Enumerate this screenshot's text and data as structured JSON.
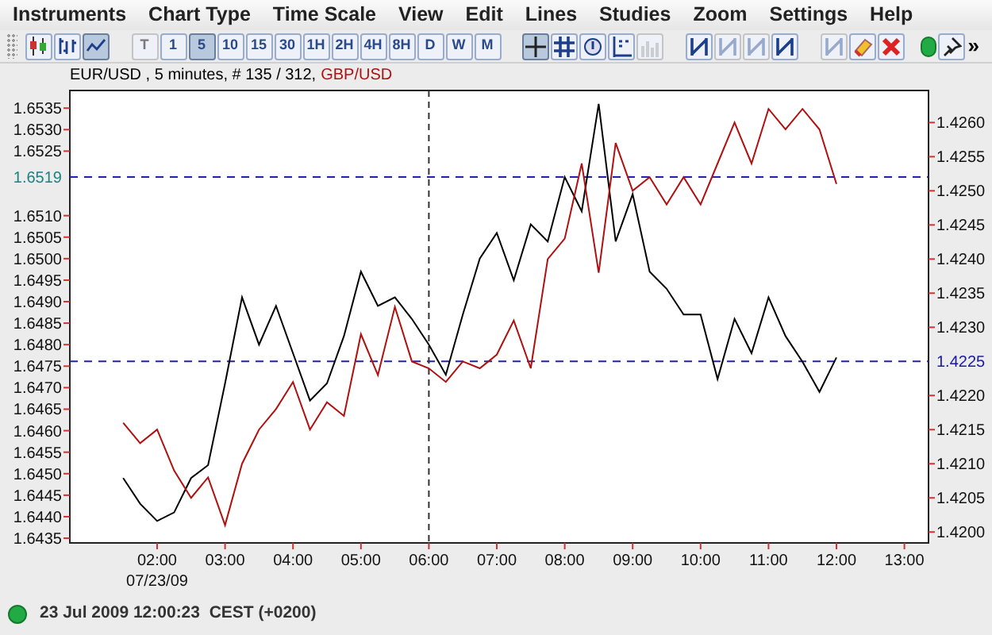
{
  "menu": [
    "Instruments",
    "Chart Type",
    "Time Scale",
    "View",
    "Edit",
    "Lines",
    "Studies",
    "Zoom",
    "Settings",
    "Help"
  ],
  "toolbar": {
    "chart_type_buttons": [
      {
        "selected": false
      },
      {
        "selected": false
      },
      {
        "selected": true
      }
    ],
    "time_scale_buttons": [
      {
        "label": "T",
        "disabled": true,
        "selected": false
      },
      {
        "label": "1",
        "disabled": false,
        "selected": false
      },
      {
        "label": "5",
        "disabled": false,
        "selected": true
      },
      {
        "label": "10",
        "disabled": false,
        "selected": false
      },
      {
        "label": "15",
        "disabled": false,
        "selected": false
      },
      {
        "label": "30",
        "disabled": false,
        "selected": false
      },
      {
        "label": "1H",
        "disabled": false,
        "selected": false
      },
      {
        "label": "2H",
        "disabled": false,
        "selected": false
      },
      {
        "label": "4H",
        "disabled": false,
        "selected": false
      },
      {
        "label": "8H",
        "disabled": false,
        "selected": false
      },
      {
        "label": "D",
        "disabled": false,
        "selected": false
      },
      {
        "label": "W",
        "disabled": false,
        "selected": false
      },
      {
        "label": "M",
        "disabled": false,
        "selected": false
      }
    ],
    "tool_buttons": [
      {
        "selected": true,
        "disabled": false
      },
      {
        "selected": false,
        "disabled": false
      },
      {
        "selected": false,
        "disabled": false
      },
      {
        "selected": false,
        "disabled": false
      },
      {
        "selected": false,
        "disabled": true
      }
    ],
    "line_buttons": [
      {
        "disabled": false
      },
      {
        "disabled": true
      },
      {
        "disabled": true
      },
      {
        "disabled": false
      }
    ],
    "edit_buttons": [
      {
        "disabled": true
      },
      {
        "disabled": false
      },
      {
        "disabled": false
      }
    ],
    "connected": true,
    "more": "»"
  },
  "chart": {
    "legend_info": " , 5 minutes, # 135 / 312,",
    "price_markers": [
      {
        "text": "1.6519",
        "color": "#208080"
      },
      {
        "text": "1.4225",
        "color": "#1a1aa0"
      }
    ],
    "date_label": "07/23/09",
    "chart_data": {
      "type": "line",
      "x": [
        1.5,
        1.75,
        2,
        2.25,
        2.5,
        2.75,
        3,
        3.25,
        3.5,
        3.75,
        4,
        4.25,
        4.5,
        4.75,
        5,
        5.25,
        5.5,
        5.75,
        6,
        6.25,
        6.5,
        6.75,
        7,
        7.25,
        7.5,
        7.75,
        8,
        8.25,
        8.5,
        8.75,
        9,
        9.25,
        9.5,
        9.75,
        10,
        10.25,
        10.5,
        10.75,
        11,
        11.25,
        11.5,
        11.75,
        12
      ],
      "series": [
        {
          "name": "EUR/USD",
          "color": "#000000",
          "values": [
            1.6449,
            1.6443,
            1.6439,
            1.6441,
            1.6449,
            1.6452,
            1.6471,
            1.6491,
            1.648,
            1.6489,
            1.6478,
            1.6467,
            1.6471,
            1.6482,
            1.6497,
            1.6489,
            1.6491,
            1.6486,
            1.648,
            1.6473,
            1.6487,
            1.65,
            1.6506,
            1.6495,
            1.6508,
            1.6504,
            1.6519,
            1.6511,
            1.6536,
            1.6504,
            1.6515,
            1.6497,
            1.6493,
            1.6487,
            1.6487,
            1.6472,
            1.6486,
            1.6478,
            1.6491,
            1.6482,
            1.6476,
            1.6469,
            1.6477
          ]
        },
        {
          "name": "GBP/USD",
          "color": "#b01010",
          "axis": "y2",
          "values": [
            1.4216,
            1.4213,
            1.4215,
            1.4209,
            1.4205,
            1.4208,
            1.4201,
            1.421,
            1.4215,
            1.4218,
            1.4222,
            1.4215,
            1.4219,
            1.4217,
            1.4229,
            1.4223,
            1.4233,
            1.4225,
            1.4224,
            1.4222,
            1.4225,
            1.4224,
            1.4226,
            1.4231,
            1.4224,
            1.424,
            1.4243,
            1.4254,
            1.4238,
            1.4257,
            1.425,
            1.4252,
            1.4248,
            1.4252,
            1.4248,
            1.4254,
            1.426,
            1.4254,
            1.4262,
            1.4259,
            1.4262,
            1.4259,
            1.4251
          ]
        }
      ],
      "xlim": [
        0.715,
        13.355
      ],
      "xticks": [
        {
          "value": 2,
          "label": "02:00"
        },
        {
          "value": 3,
          "label": "03:00"
        },
        {
          "value": 4,
          "label": "04:00"
        },
        {
          "value": 5,
          "label": "05:00"
        },
        {
          "value": 6,
          "label": "06:00"
        },
        {
          "value": 7,
          "label": "07:00"
        },
        {
          "value": 8,
          "label": "08:00"
        },
        {
          "value": 9,
          "label": "09:00"
        },
        {
          "value": 10,
          "label": "10:00"
        },
        {
          "value": 11,
          "label": "11:00"
        },
        {
          "value": 12,
          "label": "12:00"
        },
        {
          "value": 13,
          "label": "13:00"
        }
      ],
      "ylim": [
        1.64339,
        1.65391
      ],
      "yticks": [
        {
          "value": 1.6435,
          "label": "1.6435"
        },
        {
          "value": 1.644,
          "label": "1.6440"
        },
        {
          "value": 1.6445,
          "label": "1.6445"
        },
        {
          "value": 1.645,
          "label": "1.6450"
        },
        {
          "value": 1.6455,
          "label": "1.6455"
        },
        {
          "value": 1.646,
          "label": "1.6460"
        },
        {
          "value": 1.6465,
          "label": "1.6465"
        },
        {
          "value": 1.647,
          "label": "1.6470"
        },
        {
          "value": 1.6475,
          "label": "1.6475"
        },
        {
          "value": 1.648,
          "label": "1.6480"
        },
        {
          "value": 1.6485,
          "label": "1.6485"
        },
        {
          "value": 1.649,
          "label": "1.6490"
        },
        {
          "value": 1.6495,
          "label": "1.6495"
        },
        {
          "value": 1.65,
          "label": "1.6500"
        },
        {
          "value": 1.6505,
          "label": "1.6505"
        },
        {
          "value": 1.651,
          "label": "1.6510"
        },
        {
          "value": 1.6525,
          "label": "1.6525"
        },
        {
          "value": 1.653,
          "label": "1.6530"
        },
        {
          "value": 1.6535,
          "label": "1.6535"
        }
      ],
      "y2lim": [
        1.41984,
        1.42647
      ],
      "y2ticks": [
        {
          "value": 1.42,
          "label": "1.4200"
        },
        {
          "value": 1.4205,
          "label": "1.4205"
        },
        {
          "value": 1.421,
          "label": "1.4210"
        },
        {
          "value": 1.4215,
          "label": "1.4215"
        },
        {
          "value": 1.422,
          "label": "1.4220"
        },
        {
          "value": 1.423,
          "label": "1.4230"
        },
        {
          "value": 1.4235,
          "label": "1.4235"
        },
        {
          "value": 1.424,
          "label": "1.4240"
        },
        {
          "value": 1.4245,
          "label": "1.4245"
        },
        {
          "value": 1.425,
          "label": "1.4250"
        },
        {
          "value": 1.4255,
          "label": "1.4255"
        },
        {
          "value": 1.426,
          "label": "1.4260"
        }
      ],
      "ref_lines": [
        {
          "axis": "y",
          "value": 1.6519,
          "color": "#2222aa"
        },
        {
          "axis": "y2",
          "value": 1.4225,
          "color": "#2222aa"
        },
        {
          "axis": "x",
          "value": 6
        }
      ]
    }
  },
  "status_bar": {
    "connected": true,
    "text": "23 Jul 2009 12:00:23  CEST (+0200)"
  }
}
